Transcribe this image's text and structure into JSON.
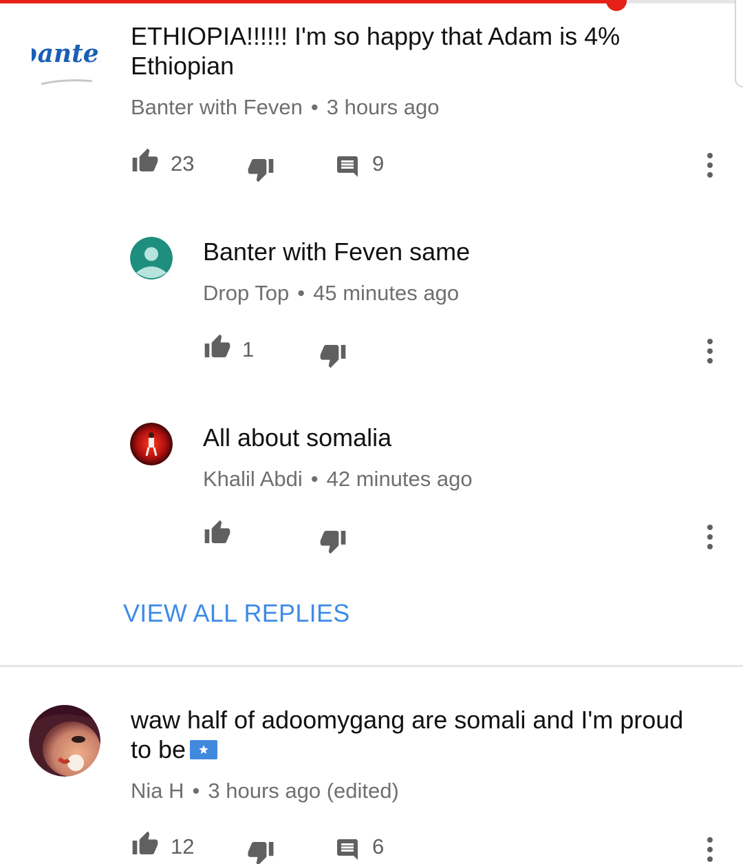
{
  "video_progress": 0.83,
  "colors": {
    "accent_red": "#e62117",
    "link_blue": "#3e8be6",
    "meta_gray": "#6f6f6f"
  },
  "comments": [
    {
      "text": "ETHIOPIA!!!!!! I'm so happy that Adam is 4% Ethiopian",
      "text_line1": "ETHIOPIA!!!!!! I'm so happy that Adam is 4%",
      "text_line2": "Ethiopian",
      "author": "Banter with Feven",
      "time": "3 hours ago",
      "likes": "23",
      "replies": "9",
      "avatar_logo_text": "banter",
      "replies_list": [
        {
          "text": "Banter with Feven same",
          "author": "Drop Top",
          "time": "45 minutes ago",
          "likes": "1"
        },
        {
          "text": "All about somalia",
          "author": "Khalil Abdi",
          "time": "42 minutes ago",
          "likes": ""
        }
      ],
      "view_all_replies_label": "VIEW ALL REPLIES"
    },
    {
      "text_line1": "waw half of adoomygang are somali and I'm proud",
      "text_line2": "to be",
      "emoji": "somalia-flag",
      "author": "Nia H",
      "time": "3 hours ago (edited)",
      "likes": "12",
      "replies": "6"
    }
  ],
  "separator": "•",
  "icons": {
    "like": "thumb-up-icon",
    "dislike": "thumb-down-icon",
    "reply": "comment-icon",
    "more": "more-vert-icon"
  }
}
